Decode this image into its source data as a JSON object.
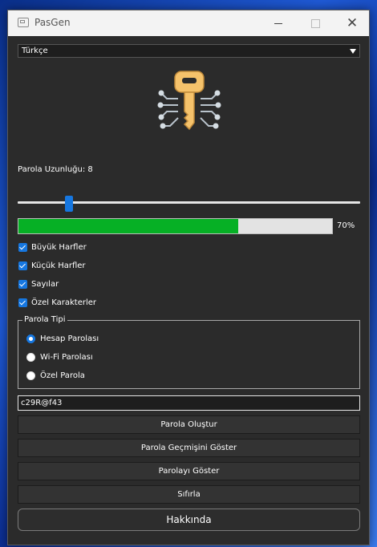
{
  "window": {
    "title": "PasGen"
  },
  "language": {
    "selected": "Türkçe"
  },
  "length": {
    "label": "Parola Uzunluğu: 8",
    "slider_fraction": 0.15
  },
  "strength": {
    "fraction": 0.7,
    "text": "70%"
  },
  "options": [
    {
      "label": "Büyük Harfler",
      "checked": true
    },
    {
      "label": "Küçük Harfler",
      "checked": true
    },
    {
      "label": "Sayılar",
      "checked": true
    },
    {
      "label": "Özel Karakterler",
      "checked": true
    }
  ],
  "password_type": {
    "title": "Parola Tipi",
    "options": [
      {
        "label": "Hesap Parolası",
        "selected": true
      },
      {
        "label": "Wi-Fi Parolası",
        "selected": false
      },
      {
        "label": "Özel Parola",
        "selected": false
      }
    ]
  },
  "output": {
    "value": "c29R@f43"
  },
  "buttons": {
    "generate": "Parola Oluştur",
    "history": "Parola Geçmişini Göster",
    "show": "Parolayı Göster",
    "reset": "Sıfırla",
    "about": "Hakkında"
  },
  "icons": {
    "app": "window-icon",
    "key": "key-circuit-icon",
    "minimize": "minimize-icon",
    "maximize": "maximize-icon",
    "close": "close-icon"
  },
  "colors": {
    "accent": "#1677e0",
    "progress": "#06b025",
    "key": "#f5c26b"
  }
}
